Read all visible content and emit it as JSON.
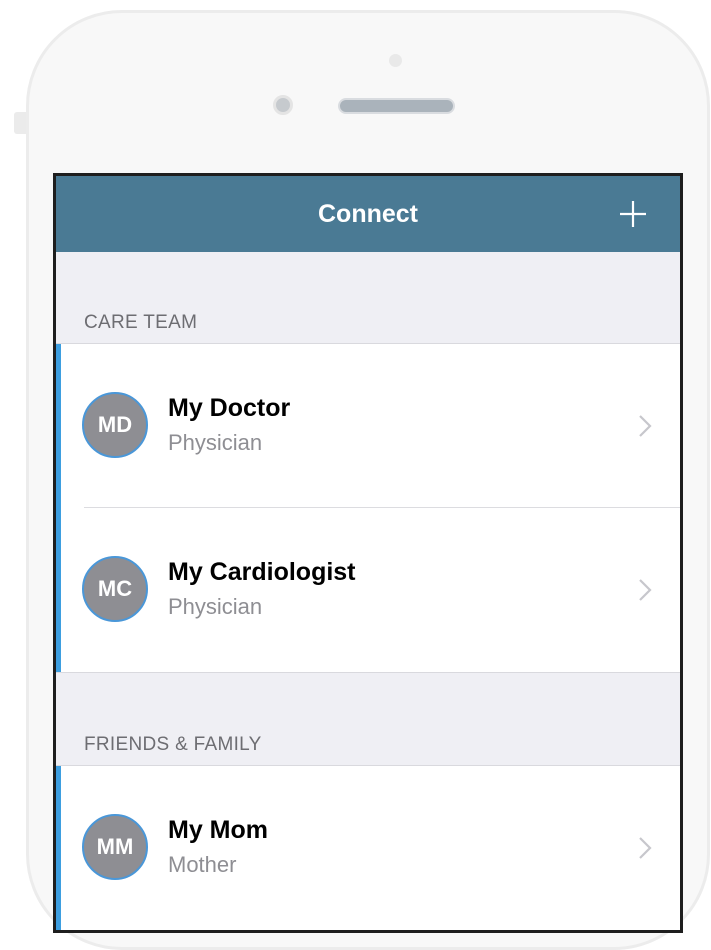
{
  "navbar": {
    "title": "Connect",
    "add_icon": "plus-icon"
  },
  "care_team": {
    "header": "CARE TEAM",
    "members": [
      {
        "initials": "MD",
        "name": "My Doctor",
        "role": "Physician"
      },
      {
        "initials": "MC",
        "name": "My Cardiologist",
        "role": "Physician"
      }
    ]
  },
  "friends_family": {
    "header": "FRIENDS & FAMILY",
    "members": [
      {
        "initials": "MM",
        "name": "My Mom",
        "role": "Mother"
      }
    ]
  },
  "colors": {
    "navbar": "#4a7a94",
    "accent": "#3d9ee0",
    "avatar": "#8e8e93",
    "background": "#efeff4"
  },
  "icons": {
    "chevron": "chevron-right-icon"
  }
}
